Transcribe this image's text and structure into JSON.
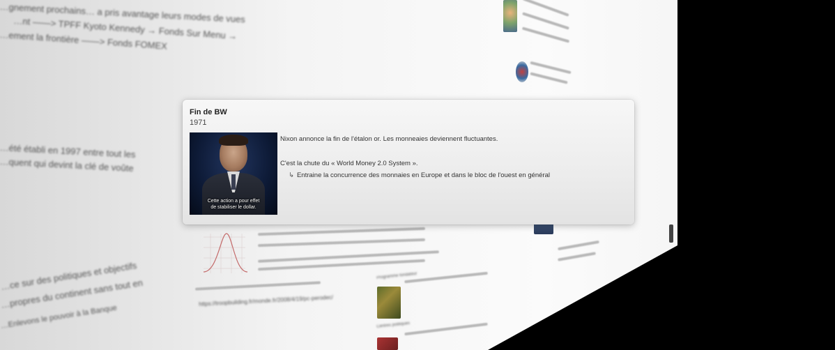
{
  "popup": {
    "title": "Fin de BW",
    "year": "1971",
    "video_subtitle_line1": "Cette action a pour effet",
    "video_subtitle_line2": "de stabiliser le dollar.",
    "text_line1": "Nixon annonce la fin de l'étalon or. Les monneaies deviennent fluctuantes.",
    "text_line2": "C'est la chute du « World Money 2.0 System ».",
    "text_line3_arrow": "↳",
    "text_line3": "Entraine la concurrence des monnaies en Europe et dans le bloc de l'ouest en général"
  },
  "background": {
    "blur_line1": "…gnement prochains… a pris avantage leurs modes de vues",
    "blur_line2": "…nt ——> TPFF Kyoto Kennedy → Fonds Sur Menu →",
    "blur_line3": "…ement la frontière ——> Fonds FOMEX",
    "blur_line4": "…été établi en 1997 entre tout les",
    "blur_line5": "…quent qui devint la clé de voûte",
    "blur_line6": "…ce sur des politiques et objectifs",
    "blur_line7": "…propres du continent sans tout en",
    "blur_line8": "…Enlevons le pouvoir à la Banque",
    "url_fragment": "https://troopbuilding.fr/monde.fr/2008/4/19/pc-perodec/",
    "side_label1": "Programme fondateur",
    "side_label2": "Centres politiques"
  },
  "icons": {
    "video": "video-thumbnail-icon",
    "chart": "bell-curve-chart"
  }
}
